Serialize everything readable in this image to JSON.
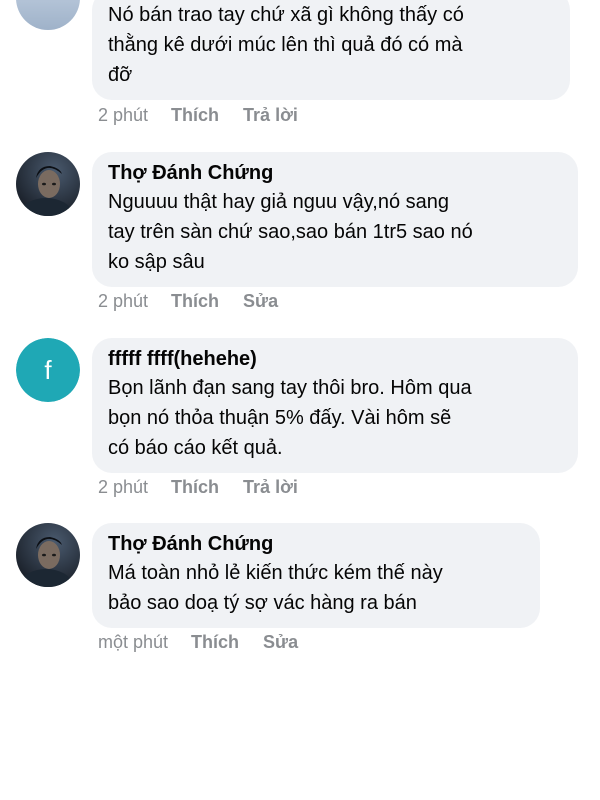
{
  "comments": [
    {
      "author": "",
      "text": "Nó bán trao tay chứ xã gì không thấy có\nthằng kê dưới múc lên thì quả đó có mà\nđỡ",
      "time": "2 phút",
      "like": "Thích",
      "reply": "Trả lời",
      "avatar": "user-avatar-partial"
    },
    {
      "author": "Thợ Đánh Chứng",
      "text": "Nguuuu thật hay giả nguu vậy,nó sang\ntay trên sàn chứ sao,sao bán 1tr5 sao nó\nko sập sâu",
      "time": "2 phút",
      "like": "Thích",
      "reply": "Sửa",
      "avatar": "dark-portrait-avatar"
    },
    {
      "author": "fffff ffff(hehehe)",
      "text": "Bọn lãnh đạn sang tay thôi bro. Hôm qua\nbọn nó thỏa thuận 5% đấy. Vài hôm sẽ\ncó báo cáo kết quả.",
      "time": "2 phút",
      "like": "Thích",
      "reply": "Trả lời",
      "avatar": "letter-f-avatar",
      "avatar_letter": "f",
      "avatar_color": "#1fa8b5"
    },
    {
      "author": "Thợ Đánh Chứng",
      "text": "Má toàn nhỏ lẻ kiến thức kém thế này\nbảo sao doạ tý sợ vác hàng ra bán",
      "time": "một phút",
      "like": "Thích",
      "reply": "Sửa",
      "avatar": "dark-portrait-avatar"
    }
  ],
  "colors": {
    "bubble": "#f0f2f5",
    "text": "#050505",
    "meta": "#8a8d91"
  }
}
